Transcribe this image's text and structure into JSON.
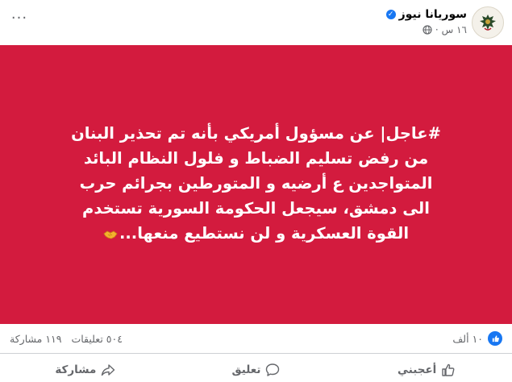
{
  "header": {
    "page_name": "سوريانا نيوز",
    "timestamp": "١٦ س",
    "separator": "·",
    "verified_icon": "verified-badge",
    "privacy_icon": "globe-icon",
    "more_icon": "more-options-icon",
    "more_glyph": "···"
  },
  "post": {
    "hashtag": "#عاجل|",
    "text": " عن مسؤول أمريكي بأنه تم تحذير البنان من رفض تسليم الضباط و فلول النظام البائد المتواجدين ع أرضيه و المتورطين بجرائم حرب الى دمشق، سيجعل الحكومة السورية تستخدم القوة العسكرية و لن نستطيع منعها...",
    "emoji": "handshake-emoji",
    "background_color": "#d31b3e",
    "text_color": "#ffffff"
  },
  "stats": {
    "reactions_count": "١٠ ألف",
    "comments": "٥٠٤ تعليقات",
    "shares": "١١٩ مشاركة",
    "reaction_icon": "like-reaction-icon"
  },
  "actions": {
    "like": "أعجبني",
    "comment": "تعليق",
    "share": "مشاركة"
  }
}
